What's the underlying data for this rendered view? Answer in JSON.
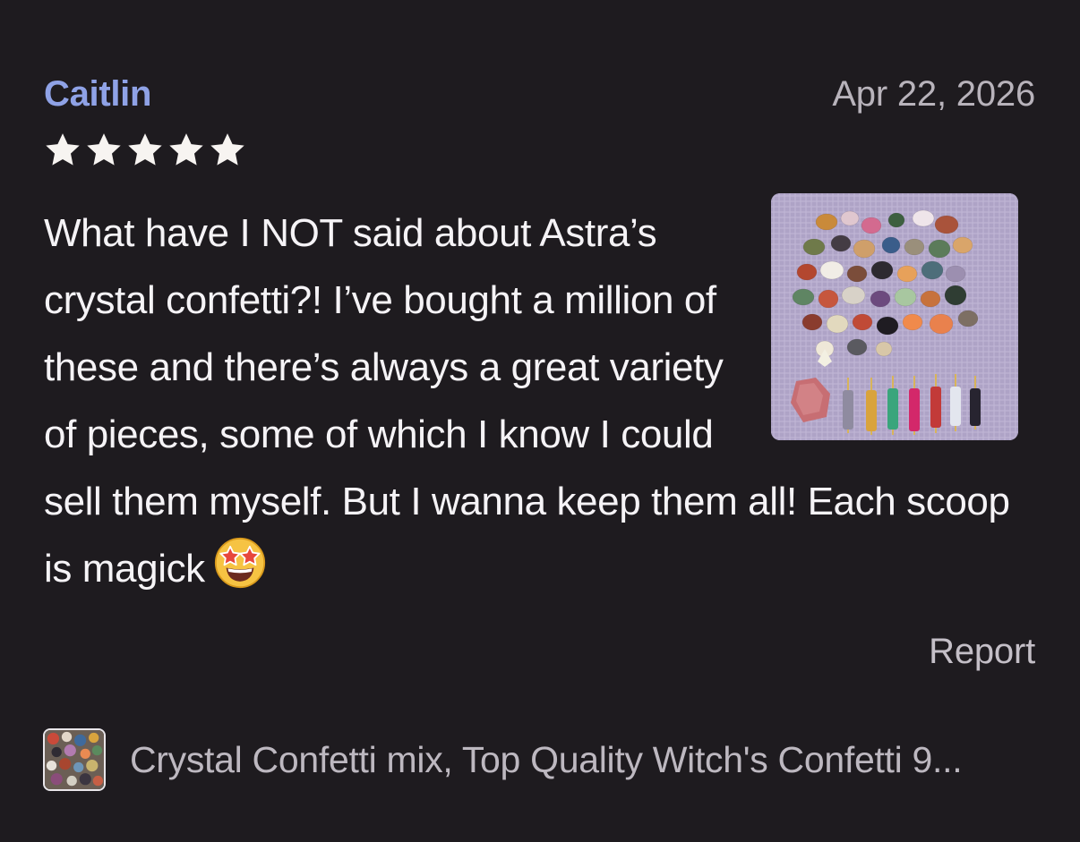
{
  "review": {
    "reviewer_name": "Caitlin",
    "date": "Apr 22, 2026",
    "rating": 5,
    "rating_max": 5,
    "text": "What have I NOT said about Astra’s crystal confetti?! I’ve bought a million of these and there’s always a great variety of pieces, some of which I know I could sell them myself. But I wanna keep them all! Each scoop is magick",
    "emoji": "star-struck-emoji",
    "photo": "review-photo-crystals"
  },
  "actions": {
    "report_label": "Report"
  },
  "product": {
    "title": "Crystal Confetti mix, Top Quality Witch's Confetti 9...",
    "thumbnail": "product-thumbnail"
  },
  "colors": {
    "background": "#1e1b1f",
    "reviewer_name": "#8fa2e6",
    "body_text": "#f5f3f6",
    "muted_text": "#b8b3bb",
    "star": "#f7f4f1"
  }
}
